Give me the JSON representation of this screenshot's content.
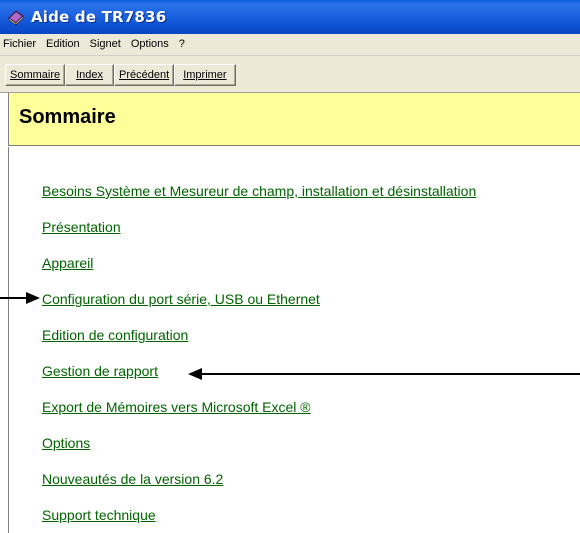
{
  "window": {
    "title": "Aide de TR7836"
  },
  "menu": [
    "Fichier",
    "Edition",
    "Signet",
    "Options",
    "?"
  ],
  "toolbar": {
    "buttons": [
      {
        "label": "Sommaire",
        "accel_underline": "S"
      },
      {
        "label": "Index",
        "accel_underline": "I"
      },
      {
        "label": "Précédent",
        "accel_underline": "P"
      },
      {
        "label": "Imprimer",
        "accel_underline": "m"
      }
    ]
  },
  "page": {
    "heading": "Sommaire"
  },
  "topics": [
    "Besoins Système et Mesureur de champ, installation et désinstallation",
    "Présentation",
    "Appareil",
    "Configuration du port série, USB ou Ethernet",
    "Edition de configuration",
    "Gestion de rapport",
    "Export de Mémoires vers Microsoft Excel ®",
    "Options",
    "Nouveautés de la version 6.2",
    "Support technique"
  ],
  "colors": {
    "link": "#006400",
    "heading_band": "#ffff99",
    "titlebar": "#0a5bd8",
    "chrome": "#ece9d8"
  }
}
